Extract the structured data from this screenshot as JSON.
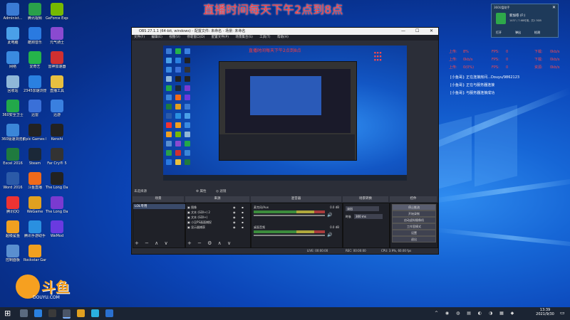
{
  "banner": "直播时间每天下午2点到8点",
  "desktop_icons": [
    {
      "label": "Administ...",
      "color": "#3b7bd4",
      "icon": "person-icon"
    },
    {
      "label": "此电脑",
      "color": "#4aa0e8",
      "icon": "computer-icon"
    },
    {
      "label": "网络",
      "color": "#3a8ae0",
      "icon": "network-icon"
    },
    {
      "label": "回收站",
      "color": "#8fb7d8",
      "icon": "recycle-bin-icon"
    },
    {
      "label": "360安全卫士",
      "color": "#22a84a",
      "icon": "shield-icon"
    },
    {
      "label": "360极速浏览器",
      "color": "#3b86d8",
      "icon": "browser-icon"
    },
    {
      "label": "Excel 2016",
      "color": "#1f7a3f",
      "icon": "excel-icon"
    },
    {
      "label": "Word 2016",
      "color": "#2b5aa8",
      "icon": "word-icon"
    },
    {
      "label": "腾讯QQ",
      "color": "#e33",
      "icon": "qq-icon"
    },
    {
      "label": "超级鲨鱼",
      "color": "#f0a020",
      "icon": "app-icon"
    },
    {
      "label": "控制面板",
      "color": "#5a8fd0",
      "icon": "control-panel-icon"
    },
    {
      "label": "腾讯视频",
      "color": "#2aa04a",
      "icon": "video-icon"
    },
    {
      "label": "酷狗音乐",
      "color": "#2a7ae0",
      "icon": "music-icon"
    },
    {
      "label": "爱奇艺",
      "color": "#25b34a",
      "icon": "video-icon"
    },
    {
      "label": "2345加速浏览器",
      "color": "#2a80e0",
      "icon": "browser-icon"
    },
    {
      "label": "迅雷",
      "color": "#3a70d8",
      "icon": "download-icon"
    },
    {
      "label": "Epic Games Launcher",
      "color": "#222",
      "icon": "epic-icon"
    },
    {
      "label": "Steam",
      "color": "#1b2838",
      "icon": "steam-icon"
    },
    {
      "label": "斗鱼直播",
      "color": "#f06a1a",
      "icon": "douyu-icon"
    },
    {
      "label": "WeGame",
      "color": "#e0a020",
      "icon": "wegame-icon"
    },
    {
      "label": "腾讯手游助手",
      "color": "#2a90e0",
      "icon": "game-icon"
    },
    {
      "label": "Rockstar Games...",
      "color": "#f0a020",
      "icon": "rockstar-icon"
    },
    {
      "label": "GeForce Experience",
      "color": "#76b900",
      "icon": "nvidia-icon"
    },
    {
      "label": "元气骑士",
      "color": "#8a4ad0",
      "icon": "game-icon"
    },
    {
      "label": "雷神加速器",
      "color": "#d03030",
      "icon": "app-icon"
    },
    {
      "label": "直播工具",
      "color": "#e8c040",
      "icon": "folder-icon"
    },
    {
      "label": "迅游",
      "color": "#3a80e0",
      "icon": "app-icon"
    },
    {
      "label": "Kenshi",
      "color": "#222",
      "icon": "game-icon"
    },
    {
      "label": "Far Cry® 5",
      "color": "#333",
      "icon": "game-icon"
    },
    {
      "label": "The Long Dark",
      "color": "#222",
      "icon": "game-icon"
    },
    {
      "label": "The Long Dark (Re...",
      "color": "#7a3ad0",
      "icon": "game-icon"
    },
    {
      "label": "WeMod",
      "color": "#6a3ae0",
      "icon": "app-icon"
    }
  ],
  "obs": {
    "title": "OBS 27.1.1 (64-bit, windows) - 配置文件: 未命名 - 场景: 未命名",
    "menu": [
      "文件(F)",
      "编辑(E)",
      "视图(V)",
      "停靠窗口(D)",
      "配置文件(P)",
      "场景集合(S)",
      "工具(T)",
      "帮助(H)"
    ],
    "preview_banner": "直播时间每天下午2点到8点",
    "no_source": "未选择源",
    "btn_properties": "属性",
    "btn_filters": "滤镜",
    "docks": {
      "scenes": "场景",
      "sources": "来源",
      "mixer": "混音器",
      "transitions": "场景转换",
      "controls": "控件"
    },
    "scenes": [
      "LOL专用"
    ],
    "sources": [
      "图像",
      "文本 (GDI+) 2",
      "文本 (GDI+)",
      "小丑PS画面捕捉",
      "显示器捕获"
    ],
    "mixer": [
      {
        "name": "麦克风/Aux",
        "db": "0.0 dB"
      },
      {
        "name": "桌面音频",
        "db": "0.0 dB"
      }
    ],
    "transition": "淡出",
    "duration_label": "时长",
    "duration_value": "300 ms",
    "controls": [
      "停止推流",
      "开始录制",
      "启动虚拟摄像机",
      "工作室模式",
      "设置",
      "退出"
    ],
    "status": [
      "LIVE: 00:00:00",
      "REC: 00:00:00",
      "CPU: 3.9%, 60.00 fps"
    ]
  },
  "stats": {
    "rows": [
      [
        "上传:",
        "8%",
        "FPS:",
        "0",
        "下载:",
        "0kb/s"
      ],
      [
        "上传:",
        "0kb/s",
        "FPS:",
        "0",
        "下载:",
        "0kb/s"
      ],
      [
        "上传:",
        "0(0%)",
        "FPS:",
        "0",
        "资源:",
        "0kb/s"
      ]
    ],
    "log": [
      "[小鱼哥]: 正在连接房间...Douyu/9862123",
      "[小鱼哥]: 正在与服务器连接",
      "[小鱼哥]: 与服务器连接成功"
    ]
  },
  "notif": {
    "title": "360U盘助手",
    "name": "新加卷 (F:)",
    "size": "1437 / 7.68可用，共1 5GB",
    "actions": [
      "打开",
      "弹出",
      "检测"
    ]
  },
  "taskbar": {
    "time": "13:39",
    "date": "2021/9/30"
  },
  "douyu": {
    "name": "斗鱼",
    "site": "DOUYU.COM"
  }
}
